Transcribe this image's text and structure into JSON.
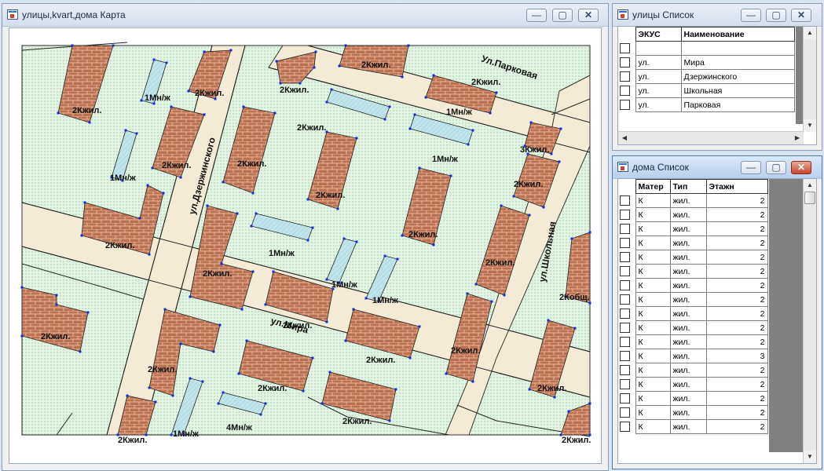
{
  "map_window": {
    "title": "улицы,kvart,дома Карта",
    "btn_min": "—",
    "btn_max": "▢",
    "btn_close": "✕",
    "streets": {
      "dzerzhinskogo": "ул.Дзержинского",
      "mira": "ул.Мира",
      "parkovaya": "Ул.Парковая",
      "shkolnaya": "ул.Школьная"
    },
    "labels": [
      "2Кжил.",
      "1Мн/ж",
      "2Кжил.",
      "2Кжил.",
      "2Кжил.",
      "1Мн/ж",
      "2Кжил.",
      "3Кжил.",
      "2Кжил.",
      "1Мн/ж",
      "1Мн/ж",
      "2Кжил.",
      "2Кжил.",
      "2Кжил.",
      "2Кжил.",
      "2Кжил.",
      "1Мн/ж",
      "1Мн/ж",
      "2Кжил.",
      "2Кжил.",
      "2Кжил.",
      "2Кжил.",
      "2Кжил.",
      "2Кобщ.",
      "2Кжил.",
      "2Кжил.",
      "2Кжил.",
      "2Кжил.",
      "2Кжил.",
      "2Кжил.",
      "1Мн/ж",
      "4Мн/ж",
      "2Кжил.",
      "1Мн/ж",
      "2Кжил."
    ]
  },
  "streets_window": {
    "title": "улицы Список",
    "btn_min": "—",
    "btn_max": "▢",
    "btn_close": "✕",
    "columns": [
      "ЭКУС",
      "Наименование"
    ],
    "rows": [
      {
        "ekus": "",
        "name": ""
      },
      {
        "ekus": "ул.",
        "name": "Мира"
      },
      {
        "ekus": "ул.",
        "name": "Дзержинского"
      },
      {
        "ekus": "ул.",
        "name": "Школьная"
      },
      {
        "ekus": "ул.",
        "name": "Парковая"
      }
    ]
  },
  "houses_window": {
    "title": "дома Список",
    "btn_min": "—",
    "btn_max": "▢",
    "btn_close": "✕",
    "columns": [
      "Матер",
      "Тип",
      "Этажн"
    ],
    "rows": [
      {
        "mater": "К",
        "tip": "жил.",
        "etazh": "2"
      },
      {
        "mater": "К",
        "tip": "жил.",
        "etazh": "2"
      },
      {
        "mater": "К",
        "tip": "жил.",
        "etazh": "2"
      },
      {
        "mater": "К",
        "tip": "жил.",
        "etazh": "2"
      },
      {
        "mater": "К",
        "tip": "жил.",
        "etazh": "2"
      },
      {
        "mater": "К",
        "tip": "жил.",
        "etazh": "2"
      },
      {
        "mater": "К",
        "tip": "жил.",
        "etazh": "2"
      },
      {
        "mater": "К",
        "tip": "жил.",
        "etazh": "2"
      },
      {
        "mater": "К",
        "tip": "жил.",
        "etazh": "2"
      },
      {
        "mater": "К",
        "tip": "жил.",
        "etazh": "2"
      },
      {
        "mater": "К",
        "tip": "жил.",
        "etazh": "2"
      },
      {
        "mater": "К",
        "tip": "жил.",
        "etazh": "3"
      },
      {
        "mater": "К",
        "tip": "жил.",
        "etazh": "2"
      },
      {
        "mater": "К",
        "tip": "жил.",
        "etazh": "2"
      },
      {
        "mater": "К",
        "tip": "жил.",
        "etazh": "2"
      },
      {
        "mater": "К",
        "tip": "жил.",
        "etazh": "2"
      },
      {
        "mater": "К",
        "tip": "жил.",
        "etazh": "2"
      }
    ]
  },
  "colors": {
    "block_fill": "#ddf0dd",
    "road_fill": "#f3ead6",
    "brick_fill": "#b96a4a",
    "wood_fill": "#b9e4ea",
    "vertex": "#1030d0"
  }
}
